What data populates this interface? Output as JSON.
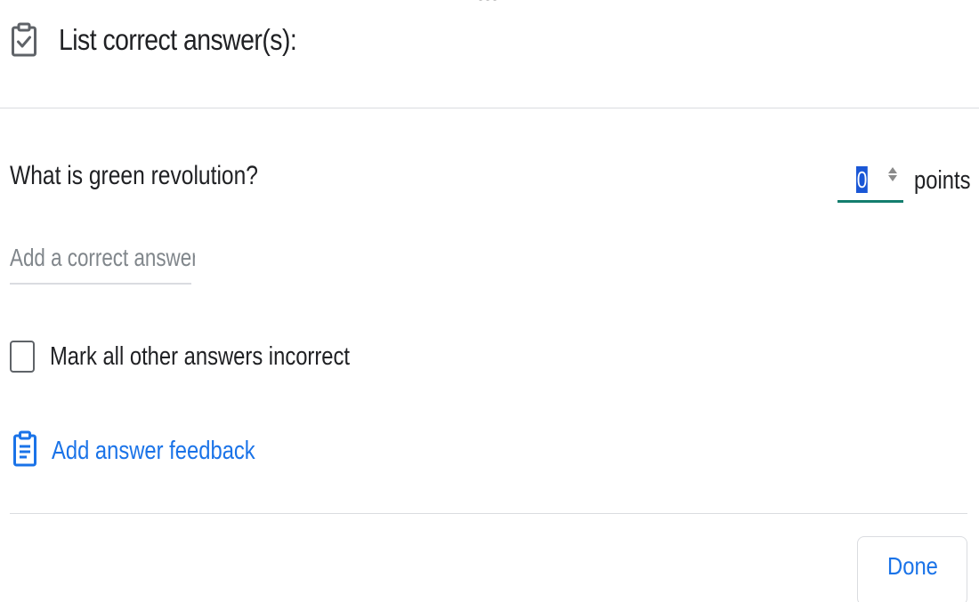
{
  "header": {
    "title": "List correct answer(s):",
    "icon": "clipboard-check-icon"
  },
  "question": {
    "text": "What is green revolution?"
  },
  "points": {
    "value": "0",
    "label": "points",
    "accent_color": "#137e6e"
  },
  "answer": {
    "placeholder": "Add a correct answer",
    "value": ""
  },
  "mark_incorrect": {
    "label": "Mark all other answers incorrect",
    "checked": false
  },
  "feedback": {
    "label": "Add answer feedback",
    "icon": "feedback-clipboard-icon",
    "color": "#1a73e8"
  },
  "actions": {
    "done_label": "Done"
  }
}
